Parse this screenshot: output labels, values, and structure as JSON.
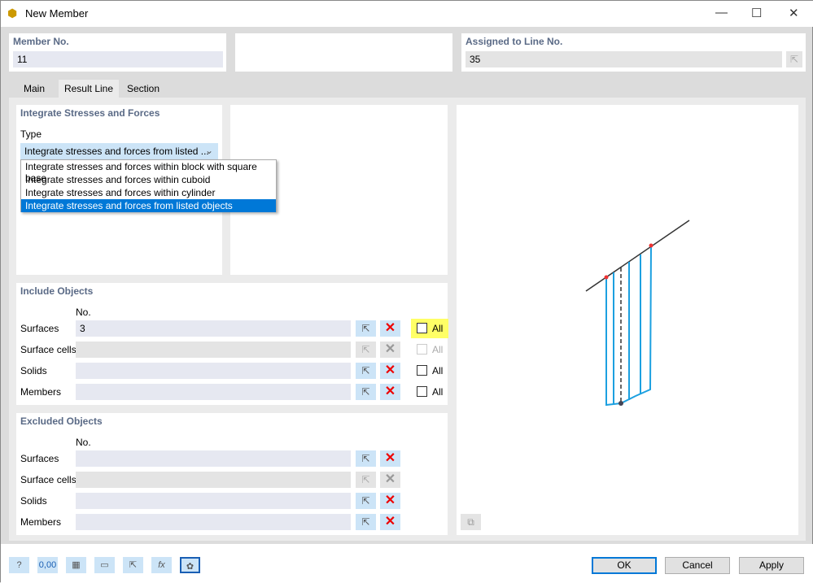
{
  "window": {
    "title": "New Member",
    "minimize": "—",
    "maximize": "☐",
    "close": "✕"
  },
  "header": {
    "member_no_label": "Member No.",
    "member_no": "11",
    "assigned_label": "Assigned to Line No.",
    "assigned_value": "35"
  },
  "tabs": [
    {
      "label": "Main"
    },
    {
      "label": "Result Line",
      "active": true
    },
    {
      "label": "Section"
    }
  ],
  "integrate": {
    "title": "Integrate Stresses and Forces",
    "type_label": "Type",
    "selected": "Integrate stresses and forces from listed ...",
    "options": [
      "Integrate stresses and forces within block with square base",
      "Integrate stresses and forces within cuboid",
      "Integrate stresses and forces within cylinder",
      "Integrate stresses and forces from listed objects"
    ]
  },
  "include": {
    "title": "Include Objects",
    "no_label": "No.",
    "rows": [
      {
        "label": "Surfaces",
        "value": "3",
        "all": "All",
        "enabled": true,
        "highlight": true
      },
      {
        "label": "Surface cells",
        "value": "",
        "all": "All",
        "enabled": false
      },
      {
        "label": "Solids",
        "value": "",
        "all": "All",
        "enabled": true
      },
      {
        "label": "Members",
        "value": "",
        "all": "All",
        "enabled": true
      }
    ]
  },
  "exclude": {
    "title": "Excluded Objects",
    "no_label": "No.",
    "rows": [
      {
        "label": "Surfaces",
        "enabled": true
      },
      {
        "label": "Surface cells",
        "enabled": false
      },
      {
        "label": "Solids",
        "enabled": true
      },
      {
        "label": "Members",
        "enabled": true
      }
    ]
  },
  "footer": {
    "ok": "OK",
    "cancel": "Cancel",
    "apply": "Apply",
    "decimal_icon_text": "0,00"
  },
  "colors": {
    "accent": "#0078d7",
    "highlight": "#ffff66",
    "delete": "#ee0000",
    "member_line": "#1ca0e0"
  }
}
